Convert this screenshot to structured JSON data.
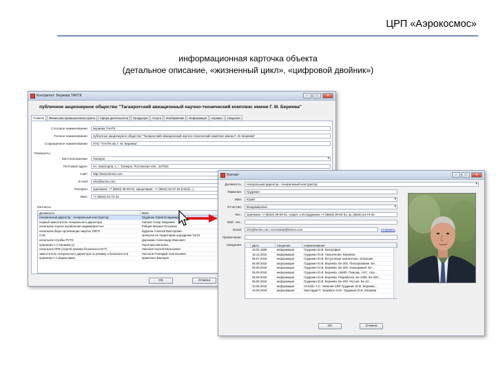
{
  "slide": {
    "title": "ЦРП «Аэрокосмос»",
    "subtitle_line1": "информационная карточка объекта",
    "subtitle_line2": "(детальное описание, «жизненный цикл», «цифровой двойник»)"
  },
  "contractor_window": {
    "title": "Контрагент: Бериева ТАНТК",
    "org_full_name": "публичное акционерное общество \"Таганрогский авиационный научно-технический комплекс имени Г. М. Бериева\"",
    "tabs": [
      {
        "label": "Главная",
        "active": true
      },
      {
        "label": "Финансово-промышленная группа",
        "active": false
      },
      {
        "label": "Сфера деятельности",
        "active": false
      },
      {
        "label": "Продукция",
        "active": false
      },
      {
        "label": "Услуги",
        "active": false
      },
      {
        "label": "Изображения",
        "active": false
      },
      {
        "label": "Информация",
        "active": false
      },
      {
        "label": "справка",
        "active": false
      },
      {
        "label": "Сведения",
        "active": false
      }
    ],
    "fields": {
      "short_name_label": "Слоговое наименование:",
      "short_name_value": "Бериева ТАНТК",
      "full_name_label": "Полное наименование:",
      "full_name_value": "публичное акционерное общество \"Таганрогский авиационный научно-технический комплекс имени Г. М. Бериева\"",
      "abbr_name_label": "Сокращенное наименование:",
      "abbr_name_value": "ПАО \"ТАНТК им. Г. М. Бериева\"",
      "requisites_label": "Реквизиты:",
      "location_label": "Местоположение:",
      "location_value": "Таганрог",
      "postal_label": "Почтовый адрес:",
      "postal_value": "пл. Авиаторов, 1, г. Таганрог, Ростовская обл., 347923",
      "site_label": "Сайт:",
      "site_value": "http://www.beriev.com",
      "email_label": "E-mail:",
      "email_value": "info@beriev.com",
      "phone_label": "Телефон:",
      "phone_value": "приемная: +7 (8634) 39-09-01, канцелярия: +7 (8634) 32-07-53 (info@...)",
      "fax_label": "Факс:",
      "fax_value": "+7 (8634) 64-74-34"
    },
    "contacts_label": "Контакты",
    "contacts_columns": [
      "Должность",
      "ФИО"
    ],
    "contacts_rows": [
      [
        "генеральный директор - генеральный конструктор",
        "Грудинин Юрий Владимирович"
      ],
      [
        "первый заместитель генерального директора",
        "Хапаев Аскер Умарович"
      ],
      [
        "начальник отдела управления недвижимостью",
        "Рябцев Михаил Петрович"
      ],
      [
        "начальник бюро организации закупок УМТО",
        "Бурунов Алексей Викторович"
      ],
      [
        "САБ",
        "пропуска на территорию аэродрома Таг10"
      ],
      [
        "начальник службы РСТО",
        "Дорожкин Александр Иванович"
      ],
      [
        "приемная А.У.Хапаева (с)",
        "Люсячина Виталия..."
      ],
      [
        "начальник ОРБ (отдела режима безопасности??)",
        "Никонов Сергей Евгеньевич"
      ],
      [
        "заместитель генерального директора по режиму и безопасности",
        "Насонов Геннадий Анатольевич"
      ],
      [
        "приемная Г.А.Карпычкина",
        "Кравченко Валерия"
      ]
    ],
    "ok_label": "OK",
    "cancel_label": "Отмена"
  },
  "contact_window": {
    "title": "Контакт",
    "fields": {
      "position_label": "Должность:",
      "position_value": "генеральный директор - генеральный конструктор",
      "surname_label": "Фамилия:",
      "surname_value": "Грудинин",
      "name_label": "Имя:",
      "name_value": "Юрий",
      "patronymic_label": "Отчество:",
      "patronymic_value": "Владимирович",
      "phone_label": "Тел.:",
      "phone_value": "приемная +7 (8634) 39-09-01, секрет. к Ю.Грудинина +7 (8634) 39-63-51, ф. (8634) 64-74-34",
      "mobile_label": "Моб. тел.:",
      "mobile_value": "",
      "email_label": "Email:",
      "email_value": "info@beriev.com; secretariat@beriev.com",
      "email_link": "отправить",
      "note_label": "Примечание:",
      "note_value": "",
      "info_label": "Сведения:"
    },
    "info_columns": [
      "Дата",
      "Сведение",
      "Наименование"
    ],
    "info_rows": [
      [
        "23.02.1959",
        "информация",
        "Грудинин Ю.В. Биография"
      ],
      [
        "15.12.2015",
        "информация",
        "Грудинин Ю.В. Назначение. Бериева"
      ],
      [
        "05.07.2018",
        "информация",
        "Грудинин Ю.В. Вступление-назначение. Ильюшин"
      ],
      [
        "05.09.2018",
        "информация",
        "Грудинин Ю.В. Бериева. Бе-200. Пенсирование. Бе..."
      ],
      [
        "05.09.2018",
        "информация",
        "Грудинин Ю.В. Бериева. Бе-200. Нашедимый. Бе-..."
      ],
      [
        "05.09.2018",
        "информация",
        "Грудинин Ю.В. Бериева. А5600. Помощь. АУС. Сер..."
      ],
      [
        "06.09.2018",
        "информация",
        "Грудинин Ю.В. Бериева. Разработка. Бе-1000. Бе-200..."
      ],
      [
        "06.09.2018",
        "информация",
        "Грудинин Ю.В. Бериева. Бе-200. Россия. Бе-12..."
      ],
      [
        "10.09.2018",
        "информация",
        "Ослабо А.С. Авиалия СВР. Грудинин Ю.В. Бериева..."
      ],
      [
        "10.09.2018",
        "информация",
        "Массарди П. Seaplane GAS. Грудинин Ю.В. Бериева"
      ]
    ],
    "ok_label": "OK",
    "cancel_label": "Отмена"
  },
  "colors": {
    "accent_rule": "#6f8fb3",
    "arrow": "#e01010",
    "selection": "#cfe0f7"
  }
}
